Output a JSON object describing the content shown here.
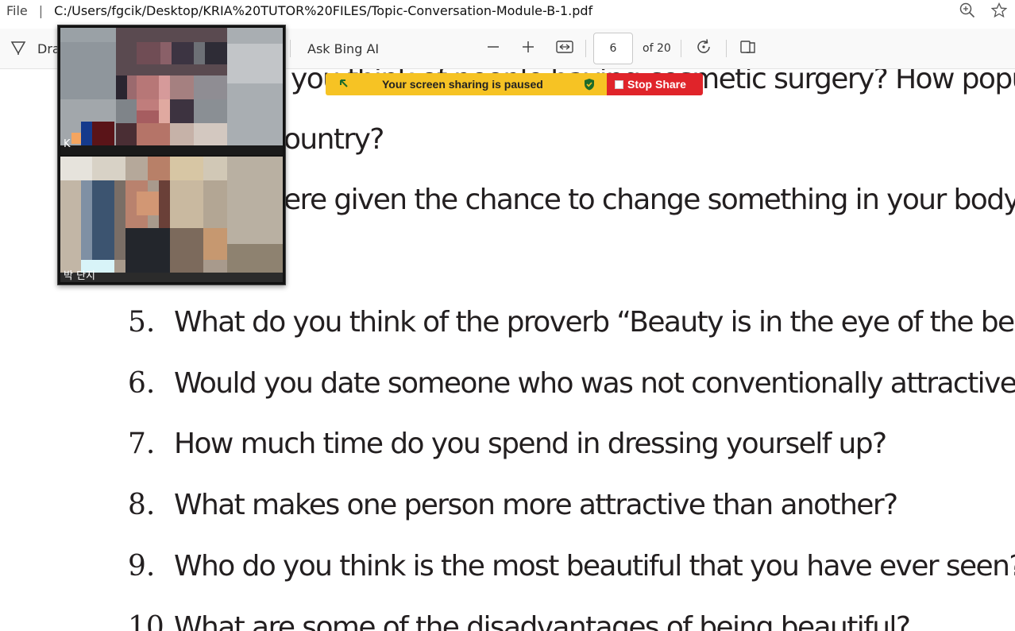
{
  "address_bar": {
    "file_label": "File",
    "separator": "|",
    "path": "C:/Users/fgcik/Desktop/KRIA%20TUTOR%20FILES/Topic-Conversation-Module-B-1.pdf",
    "icons": [
      "zoom-in-icon",
      "star-icon"
    ]
  },
  "toolbar": {
    "draw_label": "Dra",
    "ask_label": "Ask Bing AI",
    "page_value": "6",
    "page_total": "of 20",
    "icons": [
      "draw-icon",
      "minus-icon",
      "plus-icon",
      "fit-width-icon",
      "rotate-icon",
      "two-page-icon"
    ]
  },
  "document": {
    "lines": [
      {
        "text": "you think of people having cosmetic surgery? How popu"
      },
      {
        "text": "ountry?"
      },
      {
        "text": "ere given the chance to change something in your body, w"
      }
    ],
    "questions": [
      {
        "num": "5.",
        "text": "What do you think of the proverb “Beauty is in the eye of the beho"
      },
      {
        "num": "6.",
        "text": "Would you date someone who was not conventionally attractive?"
      },
      {
        "num": "7.",
        "text": "How much time do you spend in dressing yourself up?"
      },
      {
        "num": "8.",
        "text": "What makes one person more attractive than another?"
      },
      {
        "num": "9.",
        "text": "Who do you think is the most beautiful that you have ever seen?"
      },
      {
        "num": "10.",
        "text": "What are some of the disadvantages of being beautiful?"
      }
    ]
  },
  "screen_share": {
    "message": "Your screen sharing is paused",
    "stop_label": "Stop Share",
    "colors": {
      "banner": "#f6c324",
      "stop": "#e0242a"
    }
  },
  "video": {
    "top_label": "K",
    "bottom_label": "박 단지"
  }
}
